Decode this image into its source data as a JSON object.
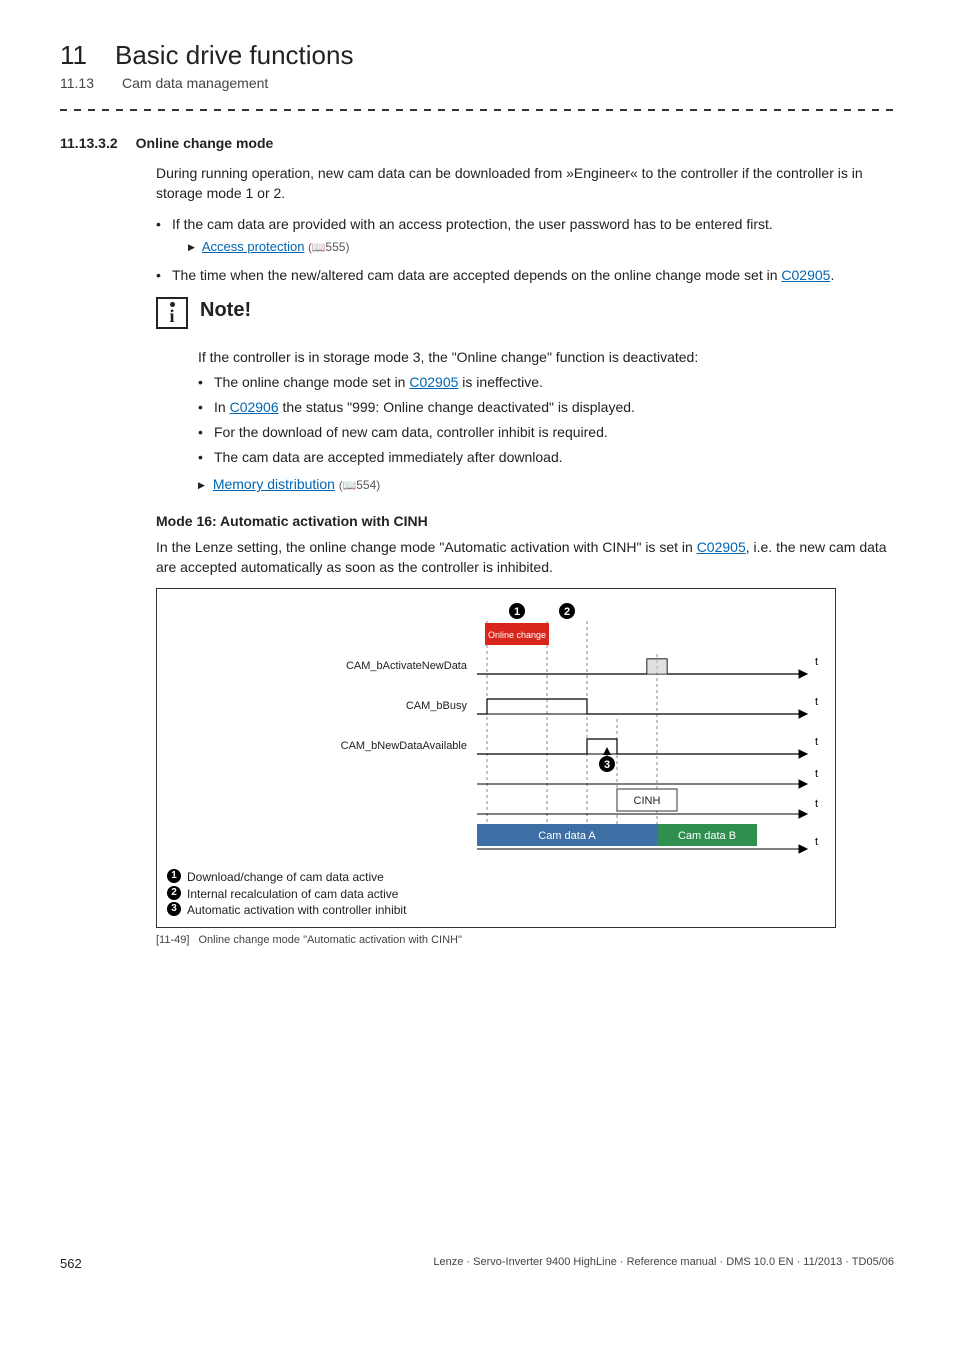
{
  "header": {
    "chapter_num": "11",
    "chapter_title": "Basic drive functions",
    "sub_num": "11.13",
    "sub_title": "Cam data management"
  },
  "section": {
    "num": "11.13.3.2",
    "title": "Online change mode"
  },
  "intro": "During running operation, new cam data can be downloaded from »Engineer« to the controller if the controller is in storage mode 1 or 2.",
  "bullets_main": [
    {
      "text": "If the cam data are provided with an access protection, the user password has to be entered first.",
      "link_label": "Access protection",
      "link_page": "555"
    },
    {
      "text_pre": "The time when the new/altered cam data are accepted depends on the online change mode set in ",
      "code_link": "C02905",
      "text_post": "."
    }
  ],
  "note": {
    "title": "Note!",
    "lead": "If the controller is in storage mode 3, the \"Online change\" function is deactivated:",
    "items": [
      {
        "pre": "The online change mode set in ",
        "link": "C02905",
        "post": " is ineffective."
      },
      {
        "pre": "In ",
        "link": "C02906",
        "post": " the status \"999: Online change deactivated\" is displayed."
      },
      {
        "plain": "For the download of new cam data, controller inhibit is required."
      },
      {
        "plain": "The cam data are accepted immediately after download."
      }
    ],
    "trailing_link": {
      "label": "Memory distribution",
      "page": "554"
    }
  },
  "mode16": {
    "heading": "Mode 16: Automatic activation with CINH",
    "para_pre": "In the Lenze setting, the online change mode \"Automatic activation with CINH\" is set in ",
    "para_link": "C02905",
    "para_post": ", i.e. the new cam data are accepted automatically as soon as the controller is inhibited."
  },
  "diagram_labels": {
    "online_change": "Online change",
    "sig1": "CAM_bActivateNewData",
    "sig2": "CAM_bBusy",
    "sig3": "CAM_bNewDataAvailable",
    "cinh": "CINH",
    "cam_a": "Cam data A",
    "cam_b": "Cam data B",
    "t": "t"
  },
  "legend": {
    "l1": "Download/change of cam data active",
    "l2": "Internal recalculation of cam data active",
    "l3": "Automatic activation with controller inhibit"
  },
  "figure": {
    "tag": "[11-49]",
    "caption": "Online change mode \"Automatic activation with CINH\""
  },
  "footer": {
    "page": "562",
    "meta": "Lenze · Servo-Inverter 9400 HighLine · Reference manual · DMS 10.0 EN · 11/2013 · TD05/06"
  }
}
